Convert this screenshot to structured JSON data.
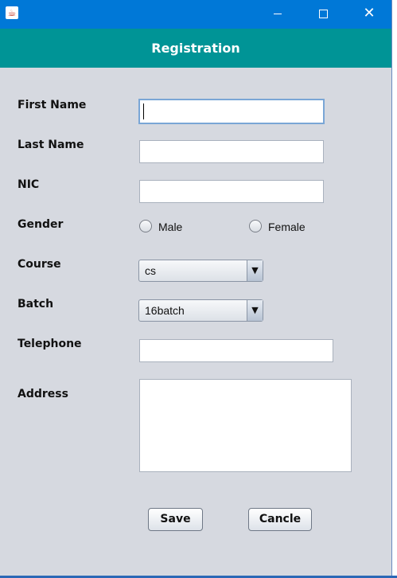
{
  "window": {
    "minimize_symbol": "",
    "close_symbol": "✕",
    "app_icon": "java-cup-icon"
  },
  "header": {
    "title": "Registration"
  },
  "form": {
    "first_name_label": "First Name",
    "last_name_label": "Last Name",
    "nic_label": "NIC",
    "gender_label": "Gender",
    "gender_male": "Male",
    "gender_female": "Female",
    "course_label": "Course",
    "course_value": "cs",
    "batch_label": "Batch",
    "batch_value": "16batch",
    "telephone_label": "Telephone",
    "address_label": "Address",
    "first_name_value": "",
    "last_name_value": "",
    "nic_value": "",
    "telephone_value": "",
    "address_value": ""
  },
  "actions": {
    "save_label": "Save",
    "cancel_label": "Cancle"
  },
  "colors": {
    "titlebar": "#0078d7",
    "header": "#009496",
    "background": "#d6d9e0"
  }
}
